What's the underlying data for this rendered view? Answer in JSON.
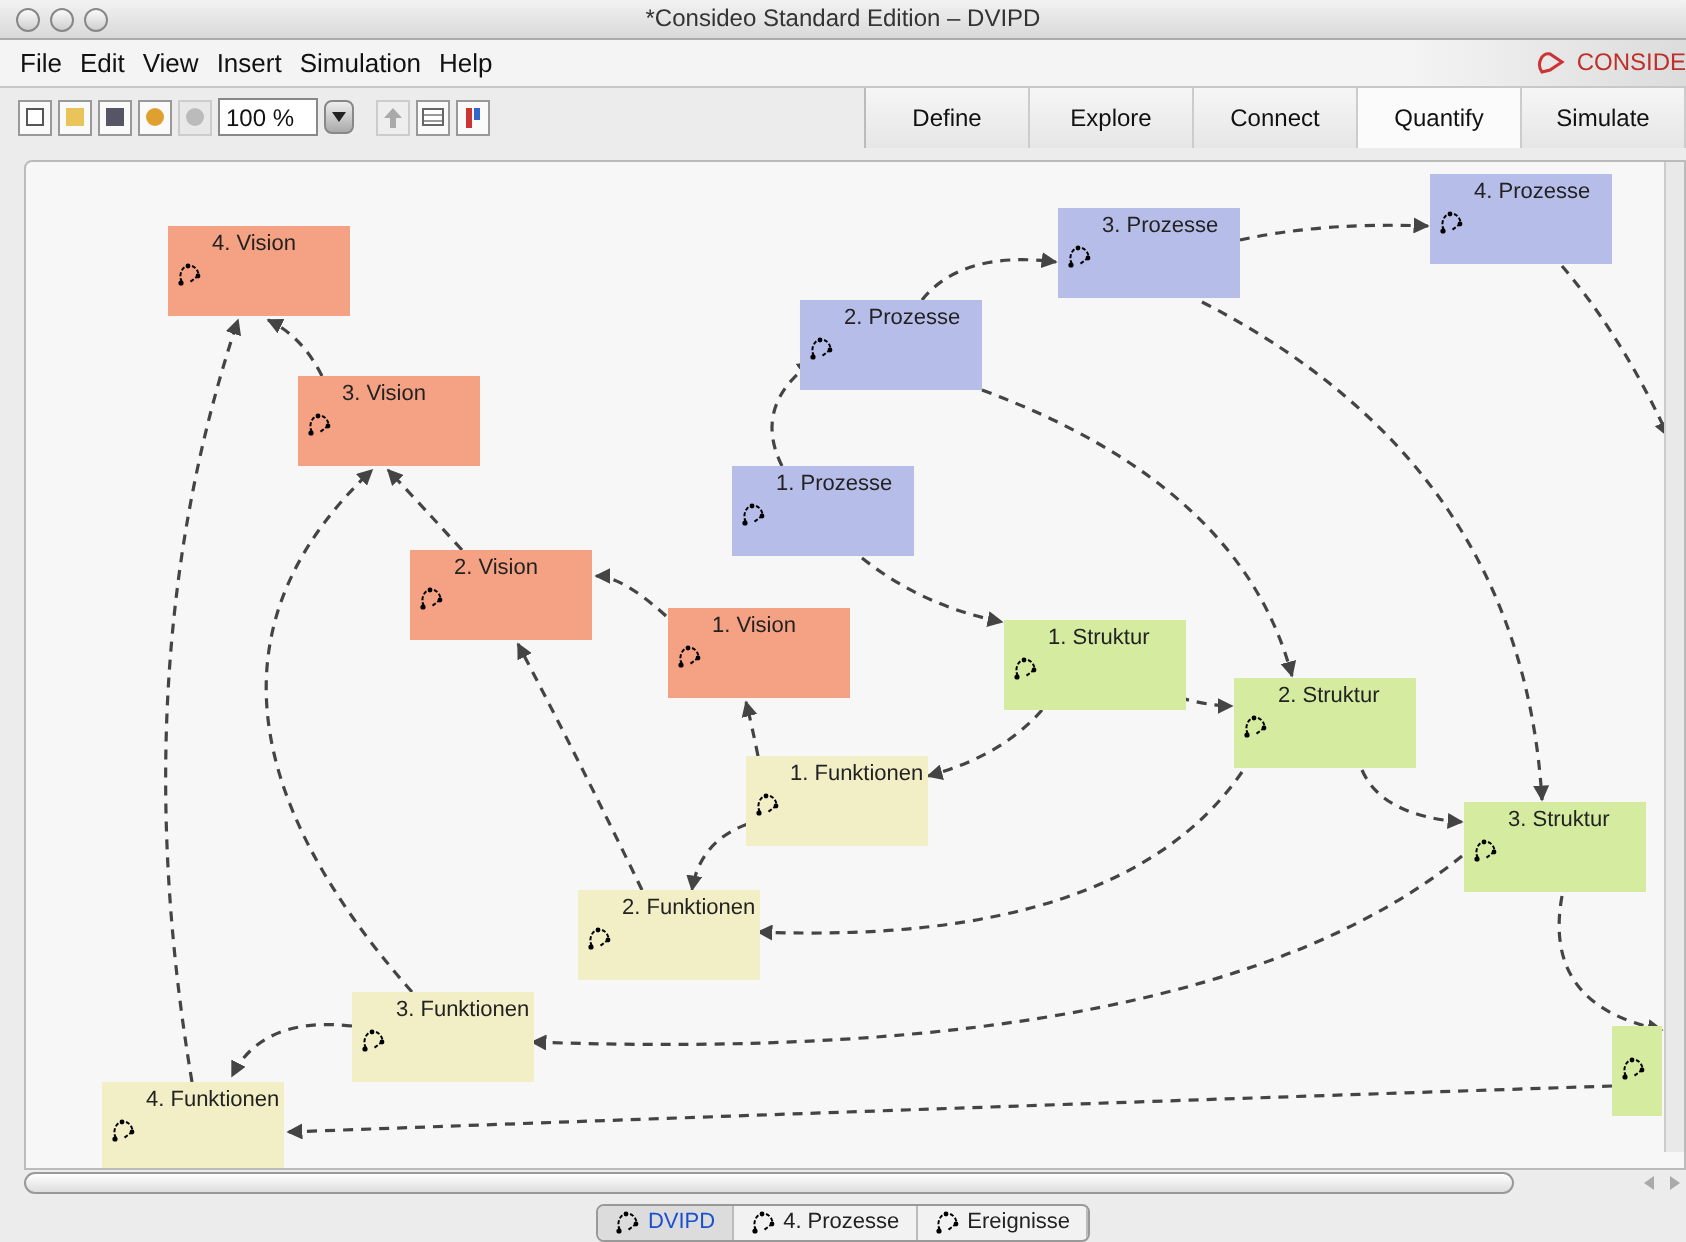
{
  "window": {
    "title": "*Consideo Standard Edition – DVIPD"
  },
  "menu": [
    "File",
    "Edit",
    "View",
    "Insert",
    "Simulation",
    "Help"
  ],
  "logo": {
    "text": "CONSIDE"
  },
  "toolbar": {
    "zoom": "100 %"
  },
  "mode_tabs": [
    {
      "label": "Define",
      "selected": false
    },
    {
      "label": "Explore",
      "selected": false
    },
    {
      "label": "Connect",
      "selected": false
    },
    {
      "label": "Quantify",
      "selected": true
    },
    {
      "label": "Simulate",
      "selected": false
    }
  ],
  "nodes": [
    {
      "label": "4. Vision",
      "kind": "vision"
    },
    {
      "label": "3. Vision",
      "kind": "vision"
    },
    {
      "label": "2. Vision",
      "kind": "vision"
    },
    {
      "label": "1. Vision",
      "kind": "vision"
    },
    {
      "label": "1. Prozesse",
      "kind": "prozesse"
    },
    {
      "label": "2. Prozesse",
      "kind": "prozesse"
    },
    {
      "label": "3. Prozesse",
      "kind": "prozesse"
    },
    {
      "label": "4. Prozesse",
      "kind": "prozesse"
    },
    {
      "label": "1. Struktur",
      "kind": "struktur"
    },
    {
      "label": "2. Struktur",
      "kind": "struktur"
    },
    {
      "label": "3. Struktur",
      "kind": "struktur"
    },
    {
      "kind": "struktur"
    },
    {
      "label": "1. Funktionen",
      "kind": "funktionen"
    },
    {
      "label": "2. Funktionen",
      "kind": "funktionen"
    },
    {
      "label": "3. Funktionen",
      "kind": "funktionen"
    },
    {
      "label": "4. Funktionen",
      "kind": "funktionen"
    }
  ],
  "model_tabs": [
    {
      "label": "DVIPD",
      "selected": true
    },
    {
      "label": "4. Prozesse",
      "selected": false
    },
    {
      "label": "Ereignisse",
      "selected": false
    }
  ]
}
